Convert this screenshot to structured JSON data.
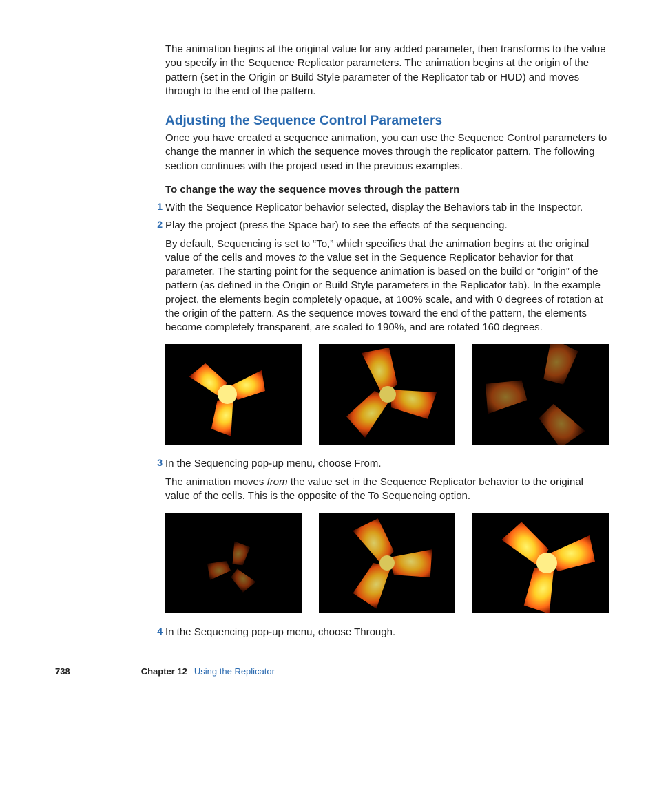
{
  "intro": "The animation begins at the original value for any added parameter, then transforms to the value you specify in the Sequence Replicator parameters. The animation begins at the origin of the pattern (set in the Origin or Build Style parameter of the Replicator tab or HUD) and moves through to the end of the pattern.",
  "section_heading": "Adjusting the Sequence Control Parameters",
  "section_intro": "Once you have created a sequence animation, you can use the Sequence Control parameters to change the manner in which the sequence moves through the replicator pattern. The following section continues with the project used in the previous examples.",
  "task_title": "To change the way the sequence moves through the pattern",
  "steps": {
    "s1": {
      "num": "1",
      "text": "With the Sequence Replicator behavior selected, display the Behaviors tab in the Inspector."
    },
    "s2": {
      "num": "2",
      "text": "Play the project (press the Space bar) to see the effects of the sequencing.",
      "detail_pre": "By default, Sequencing is set to “To,” which specifies that the animation begins at the original value of the cells and moves ",
      "detail_ital": "to",
      "detail_post": " the value set in the Sequence Replicator behavior for that parameter. The starting point for the sequence animation is based on the build or “origin” of the pattern (as defined in the Origin or Build Style parameters in the Replicator tab). In the example project, the elements begin completely opaque, at 100% scale, and with 0 degrees of rotation at the origin of the pattern. As the sequence moves toward the end of the pattern, the elements become completely transparent, are scaled to 190%, and are rotated 160 degrees."
    },
    "s3": {
      "num": "3",
      "text": "In the Sequencing pop-up menu, choose From.",
      "detail_pre": "The animation moves ",
      "detail_ital": "from",
      "detail_post": " the value set in the Sequence Replicator behavior to the original value of the cells. This is the opposite of the To Sequencing option."
    },
    "s4": {
      "num": "4",
      "text": "In the Sequencing pop-up menu, choose Through."
    }
  },
  "footer": {
    "page": "738",
    "chapter_label": "Chapter 12",
    "chapter_name": "Using the Replicator"
  },
  "images": {
    "row1": [
      "sequence-to-frame-1",
      "sequence-to-frame-2",
      "sequence-to-frame-3"
    ],
    "row2": [
      "sequence-from-frame-1",
      "sequence-from-frame-2",
      "sequence-from-frame-3"
    ]
  }
}
